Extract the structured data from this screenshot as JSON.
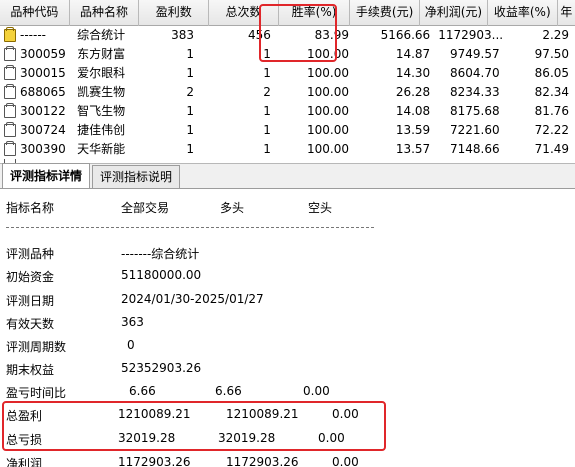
{
  "grid": {
    "headers": [
      "品种代码",
      "品种名称",
      "盈利数",
      "总次数",
      "胜率(%)",
      "手续费(元)",
      "净利润(元)",
      "收益率(%)",
      "年"
    ],
    "rows": [
      {
        "code": "------",
        "name": "综合统计",
        "wins": "383",
        "total": "456",
        "winrate": "83.99",
        "fee": "5166.66",
        "profit": "1172903...",
        "ret": "2.29",
        "icon": "summary-folder-icon"
      },
      {
        "code": "300059",
        "name": "东方财富",
        "wins": "1",
        "total": "1",
        "winrate": "100.00",
        "fee": "14.87",
        "profit": "9749.57",
        "ret": "97.50",
        "icon": "stock-page-icon"
      },
      {
        "code": "300015",
        "name": "爱尔眼科",
        "wins": "1",
        "total": "1",
        "winrate": "100.00",
        "fee": "14.30",
        "profit": "8604.70",
        "ret": "86.05",
        "icon": "stock-page-icon"
      },
      {
        "code": "688065",
        "name": "凯赛生物",
        "wins": "2",
        "total": "2",
        "winrate": "100.00",
        "fee": "26.28",
        "profit": "8234.33",
        "ret": "82.34",
        "icon": "stock-page-icon"
      },
      {
        "code": "300122",
        "name": "智飞生物",
        "wins": "1",
        "total": "1",
        "winrate": "100.00",
        "fee": "14.08",
        "profit": "8175.68",
        "ret": "81.76",
        "icon": "stock-page-icon"
      },
      {
        "code": "300724",
        "name": "捷佳伟创",
        "wins": "1",
        "total": "1",
        "winrate": "100.00",
        "fee": "13.59",
        "profit": "7221.60",
        "ret": "72.22",
        "icon": "stock-page-icon"
      },
      {
        "code": "300390",
        "name": "天华新能",
        "wins": "1",
        "total": "1",
        "winrate": "100.00",
        "fee": "13.57",
        "profit": "7148.66",
        "ret": "71.49",
        "icon": "stock-page-icon"
      }
    ]
  },
  "tabs": {
    "detail": "评测指标详情",
    "explain": "评测指标说明"
  },
  "detail": {
    "col_headers": {
      "name": "指标名称",
      "all": "全部交易",
      "long": "多头",
      "short": "空头"
    },
    "items": {
      "symbol": {
        "label": "评测品种",
        "value": "-------综合统计"
      },
      "capital": {
        "label": "初始资金",
        "value": "51180000.00"
      },
      "date": {
        "label": "评测日期",
        "value": "2024/01/30-2025/01/27"
      },
      "days": {
        "label": "有效天数",
        "value": "363"
      },
      "periods": {
        "label": "评测周期数",
        "value": "0"
      },
      "equity": {
        "label": "期末权益",
        "value": "52352903.26"
      },
      "ratio": {
        "label": "盈亏时间比",
        "all": "6.66",
        "long": "6.66",
        "short": "0.00"
      },
      "gross_profit": {
        "label": "总盈利",
        "all": "1210089.21",
        "long": "1210089.21",
        "short": "0.00"
      },
      "gross_loss": {
        "label": "总亏损",
        "all": "32019.28",
        "long": "32019.28",
        "short": "0.00"
      },
      "net_profit": {
        "label": "净利润",
        "all": "1172903.26",
        "long": "1172903.26",
        "short": "0.00"
      }
    }
  },
  "colors": {
    "highlight": "#e0262a"
  }
}
